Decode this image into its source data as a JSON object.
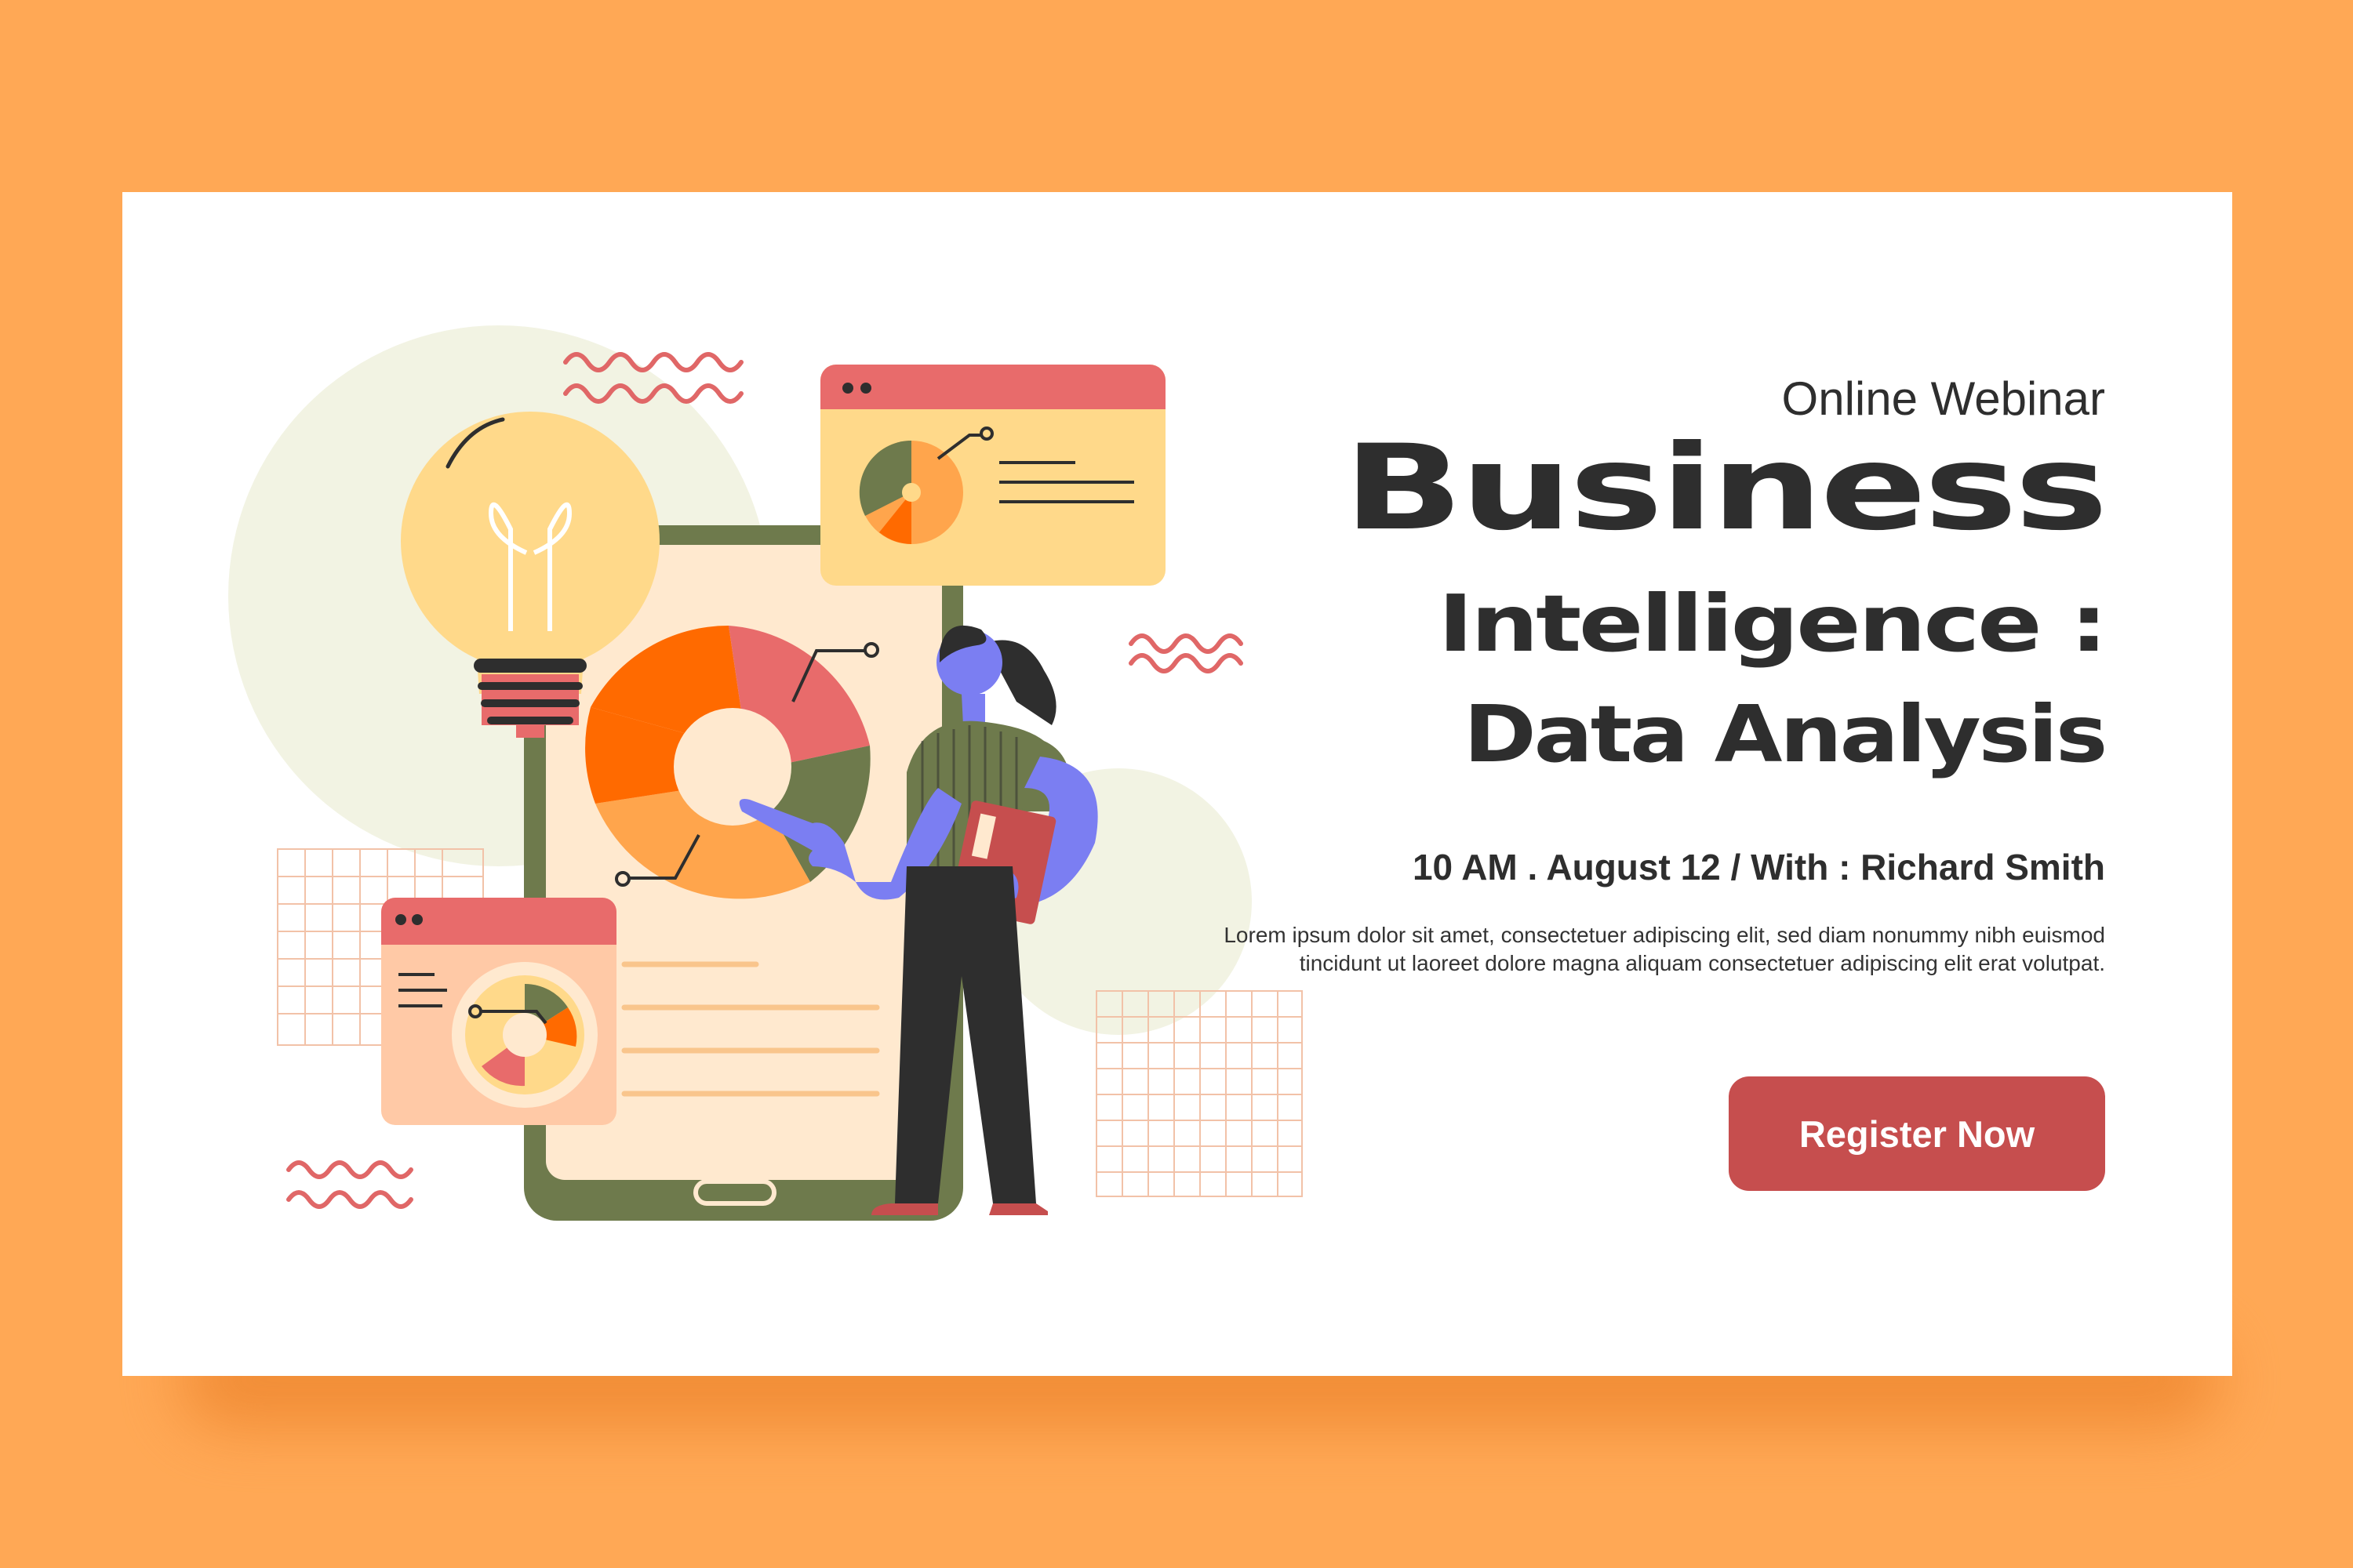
{
  "webinar": {
    "eyebrow": "Online Webinar",
    "title_line1": "Business",
    "title_line2": "Intelligence :",
    "title_line3": "Data Analysis",
    "meta": "10 AM . August 12 / With : Richard Smith",
    "description": "Lorem ipsum dolor sit amet, consectetuer adipiscing elit, sed diam nonummy nibh euismod tincidunt ut laoreet dolore magna aliquam consectetuer adipiscing elit erat volutpat.",
    "cta_label": "Register Now"
  },
  "colors": {
    "background": "#FFA855",
    "card": "#FFFFFF",
    "accent_red": "#C64E4E",
    "text_dark": "#2E2E2E",
    "blob": "#F2F3E3",
    "olive": "#6E7A4C",
    "orange": "#FF6A00",
    "peach": "#FFB067",
    "salmon": "#E86B6B",
    "cream": "#FFE9CF",
    "yellow": "#FFD98A",
    "violet": "#7B7EF2"
  },
  "illustration": {
    "icons": [
      "lightbulb-icon",
      "phone-illustration",
      "pie-chart-icon",
      "browser-window-icon",
      "gauge-icon",
      "woman-presenter-illustration",
      "squiggle-decoration",
      "grid-decoration"
    ]
  }
}
